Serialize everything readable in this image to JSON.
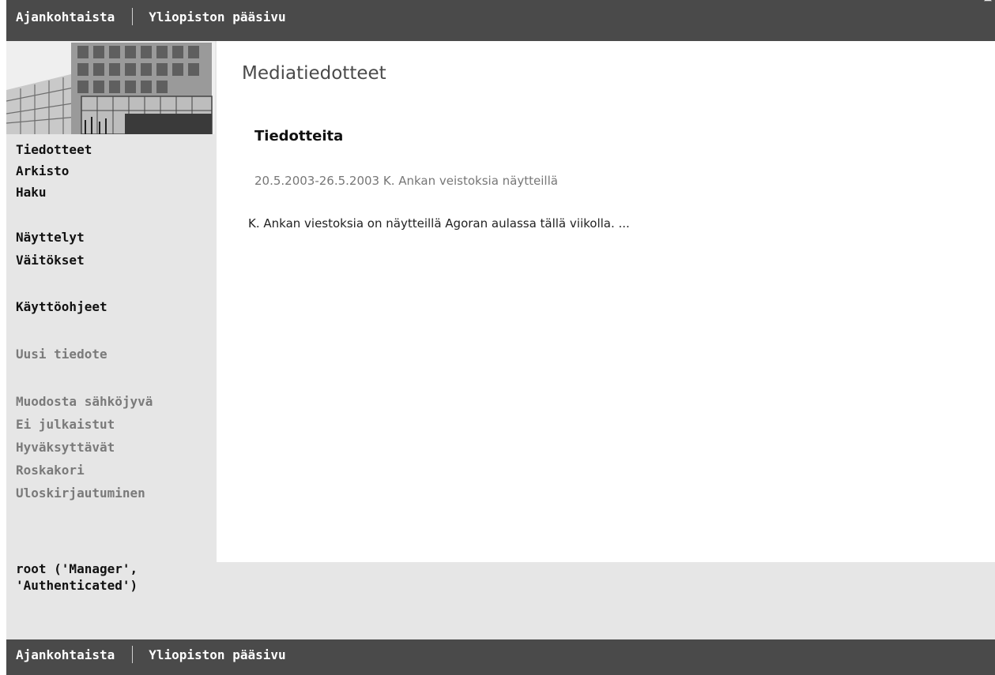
{
  "top_nav": {
    "links": [
      {
        "label": "Ajankohtaista"
      },
      {
        "label": "Yliopiston pääsivu"
      }
    ]
  },
  "bottom_nav": {
    "links": [
      {
        "label": "Ajankohtaista"
      },
      {
        "label": "Yliopiston pääsivu"
      }
    ]
  },
  "sidebar": {
    "groups": [
      {
        "items": [
          {
            "label": "Tiedotteet"
          },
          {
            "label": "Arkisto"
          },
          {
            "label": "Haku"
          }
        ]
      },
      {
        "items": [
          {
            "label": "Näyttelyt"
          },
          {
            "label": "Väitökset"
          }
        ]
      },
      {
        "items": [
          {
            "label": "Käyttöohjeet"
          }
        ]
      },
      {
        "items": [
          {
            "label": "Uusi tiedote"
          }
        ]
      },
      {
        "items": [
          {
            "label": "Muodosta sähköjyvä"
          },
          {
            "label": "Ei julkaistut"
          },
          {
            "label": "Hyväksyttävät"
          },
          {
            "label": "Roskakori"
          },
          {
            "label": "Uloskirjautuminen"
          }
        ]
      }
    ],
    "user_info": "root ('Manager',\n'Authenticated')"
  },
  "main": {
    "page_title": "Mediatiedotteet",
    "section_title": "Tiedotteita",
    "item_link": "20.5.2003-26.5.2003 K. Ankan veistoksia näytteillä",
    "item_summary": "K. Ankan viestoksia on näytteillä Agoran aulassa tällä viikolla. ..."
  },
  "colors": {
    "bar_background": "#4a4a4a",
    "sidebar_background": "#e6e6e6",
    "muted_text": "#7a7a7a"
  }
}
